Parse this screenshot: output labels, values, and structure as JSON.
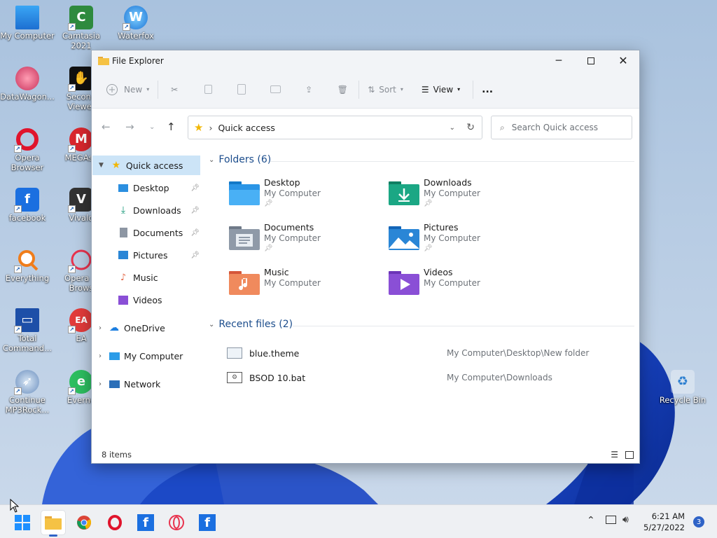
{
  "desktop": {
    "icons": [
      {
        "label": "My Computer"
      },
      {
        "label": "Camtasia 2021"
      },
      {
        "label": "Waterfox"
      },
      {
        "label": "DataWagon..."
      },
      {
        "label": "Second Viewer"
      },
      {
        "label": "Opera Browser"
      },
      {
        "label": "MEGAsy"
      },
      {
        "label": "facebook"
      },
      {
        "label": "Vivald"
      },
      {
        "label": "Everything"
      },
      {
        "label": "Opera G Brows"
      },
      {
        "label": "Total Command..."
      },
      {
        "label": "EA"
      },
      {
        "label": "Continue MP3Rock..."
      },
      {
        "label": "Everno"
      },
      {
        "label": "Recycle Bin"
      }
    ]
  },
  "window": {
    "title": "File Explorer",
    "toolbar": {
      "new_label": "New",
      "sort_label": "Sort",
      "view_label": "View",
      "more_label": "..."
    },
    "address": {
      "current": "Quick access",
      "separator": "›"
    },
    "search": {
      "placeholder": "Search Quick access"
    },
    "nav": {
      "quick_access": "Quick access",
      "pinned": [
        {
          "label": "Desktop"
        },
        {
          "label": "Downloads"
        },
        {
          "label": "Documents"
        },
        {
          "label": "Pictures"
        },
        {
          "label": "Music"
        },
        {
          "label": "Videos"
        }
      ],
      "onedrive": "OneDrive",
      "my_computer": "My Computer",
      "network": "Network"
    },
    "folders_header": "Folders (6)",
    "folders": [
      {
        "name": "Desktop",
        "location": "My Computer"
      },
      {
        "name": "Downloads",
        "location": "My Computer"
      },
      {
        "name": "Documents",
        "location": "My Computer"
      },
      {
        "name": "Pictures",
        "location": "My Computer"
      },
      {
        "name": "Music",
        "location": "My Computer"
      },
      {
        "name": "Videos",
        "location": "My Computer"
      }
    ],
    "recent_header": "Recent files (2)",
    "recent": [
      {
        "name": "blue.theme",
        "path": "My Computer\\Desktop\\New folder"
      },
      {
        "name": "BSOD 10.bat",
        "path": "My Computer\\Downloads"
      }
    ],
    "status": "8 items"
  },
  "taskbar": {
    "time": "6:21 AM",
    "date": "5/27/2022",
    "notifications": "3"
  }
}
